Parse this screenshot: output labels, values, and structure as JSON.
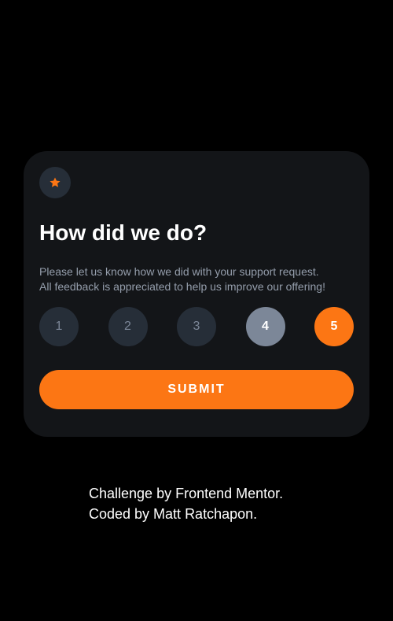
{
  "card": {
    "icon": "star-icon",
    "title": "How did we do?",
    "description_line1": "Please let us know how we did with your support request.",
    "description_line2": "All feedback is appreciated to help us improve our offering!",
    "ratings": [
      {
        "label": "1",
        "state": "default"
      },
      {
        "label": "2",
        "state": "default"
      },
      {
        "label": "3",
        "state": "default"
      },
      {
        "label": "4",
        "state": "hovered"
      },
      {
        "label": "5",
        "state": "selected"
      }
    ],
    "selected_rating": "5",
    "submit_label": "SUBMIT"
  },
  "attribution": {
    "line1": "Challenge by Frontend Mentor.",
    "line2": "Coded by Matt Ratchapon."
  },
  "colors": {
    "background": "#000000",
    "card": "#131518",
    "badge": "#262e38",
    "accent": "#fc7614",
    "muted": "#7c8798",
    "text_secondary": "#959eac"
  }
}
